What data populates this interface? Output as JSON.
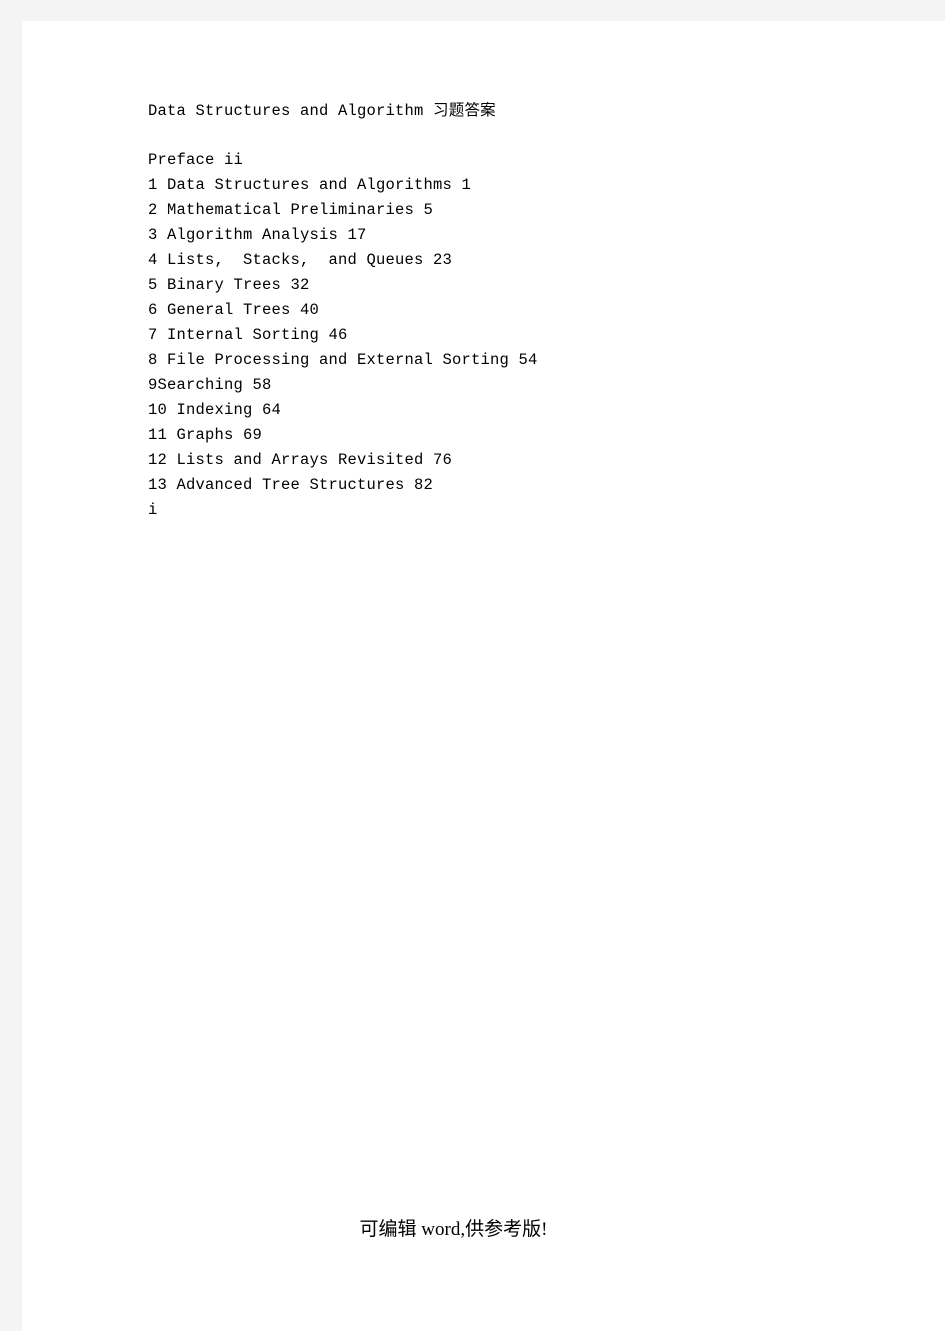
{
  "document": {
    "title": "Data Structures and Algorithm 习题答案",
    "toc": [
      "Preface ii",
      "1 Data Structures and Algorithms 1",
      "2 Mathematical Preliminaries 5",
      "3 Algorithm Analysis 17",
      "4 Lists,  Stacks,  and Queues 23",
      "5 Binary Trees 32",
      "6 General Trees 40",
      "7 Internal Sorting 46",
      "8 File Processing and External Sorting 54",
      "9Searching 58",
      "10 Indexing 64",
      "11 Graphs 69",
      "12 Lists and Arrays Revisited 76",
      "13 Advanced Tree Structures 82",
      "i"
    ],
    "footer": "可编辑 word,供参考版!",
    "colors": {
      "page_background": "#ffffff",
      "scan_margin": "#f4f4f4",
      "text": "#000000"
    }
  }
}
